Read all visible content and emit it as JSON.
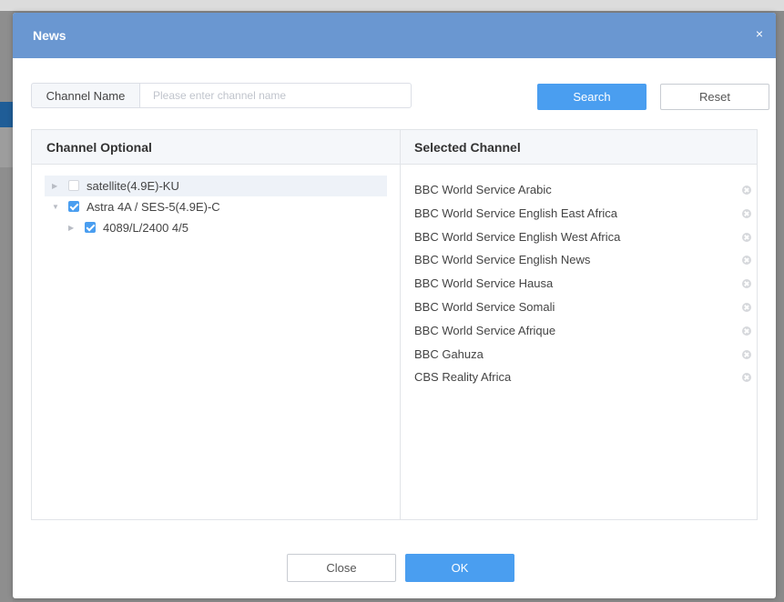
{
  "dialog": {
    "title": "News",
    "close_glyph": "×"
  },
  "filter": {
    "label": "Channel Name",
    "value": "",
    "placeholder": "Please enter channel name",
    "search_label": "Search",
    "reset_label": "Reset"
  },
  "columns": {
    "left_title": "Channel Optional",
    "right_title": "Selected Channel"
  },
  "tree": [
    {
      "label": "satellite(4.9E)-KU",
      "checked": false,
      "expanded": false,
      "level": 0
    },
    {
      "label": "Astra 4A / SES-5(4.9E)-C",
      "checked": true,
      "expanded": true,
      "level": 0
    },
    {
      "label": "4089/L/2400 4/5",
      "checked": true,
      "expanded": false,
      "level": 1
    }
  ],
  "selected": [
    "BBC World Service Arabic",
    "BBC World Service English East Africa",
    "BBC World Service English West Africa",
    "BBC World Service English News",
    "BBC World Service Hausa",
    "BBC World Service Somali",
    "BBC World Service Afrique",
    "BBC Gahuza",
    "CBS Reality Africa"
  ],
  "footer": {
    "close_label": "Close",
    "ok_label": "OK"
  },
  "colors": {
    "header": "#6a97d1",
    "primary": "#4a9ef0"
  }
}
